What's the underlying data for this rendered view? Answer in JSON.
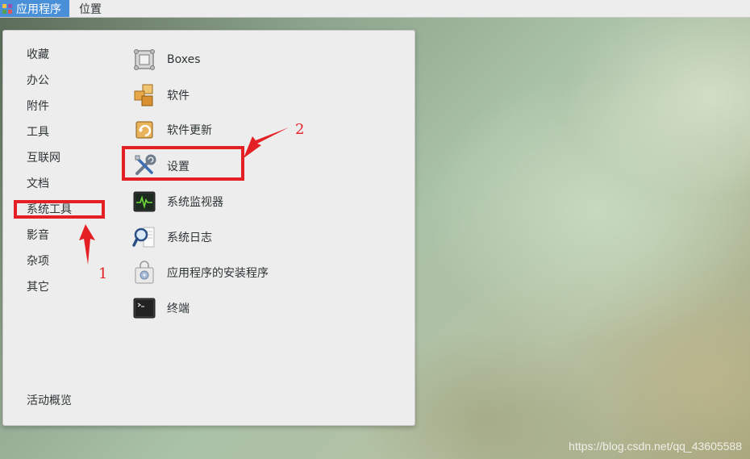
{
  "topbar": {
    "applications_label": "应用程序",
    "places_label": "位置"
  },
  "menu": {
    "categories": [
      "收藏",
      "办公",
      "附件",
      "工具",
      "互联网",
      "文档",
      "系统工具",
      "影音",
      "杂项",
      "其它"
    ],
    "activities_overview": "活动概览",
    "apps": [
      {
        "label": "Boxes",
        "icon": "boxes-icon"
      },
      {
        "label": "软件",
        "icon": "software-icon"
      },
      {
        "label": "软件更新",
        "icon": "software-update-icon"
      },
      {
        "label": "设置",
        "icon": "settings-icon"
      },
      {
        "label": "系统监视器",
        "icon": "system-monitor-icon"
      },
      {
        "label": "系统日志",
        "icon": "system-log-icon"
      },
      {
        "label": "应用程序的安装程序",
        "icon": "application-installer-icon"
      },
      {
        "label": "终端",
        "icon": "terminal-icon"
      }
    ]
  },
  "annotations": {
    "step1": "1",
    "step2": "2",
    "color": "#e52025"
  },
  "watermark": "https://blog.csdn.net/qq_43605588"
}
